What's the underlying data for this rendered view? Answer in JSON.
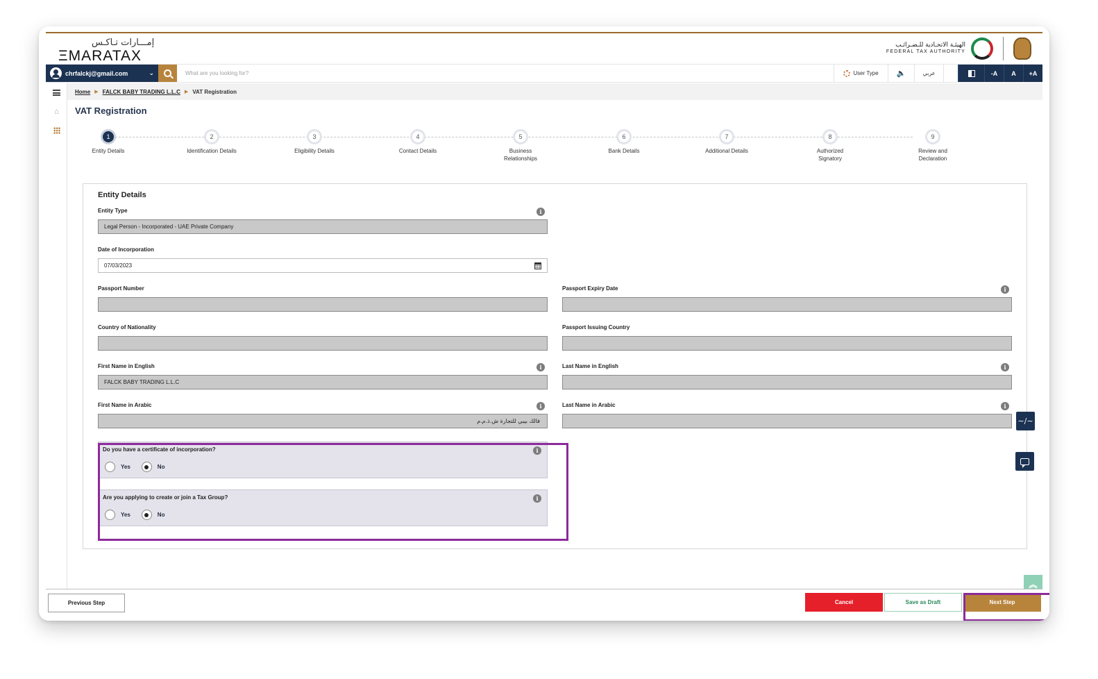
{
  "header": {
    "logo_ar": "إمـــارات تـاكـس",
    "logo_en": "ΞMARATAX",
    "fta_ar": "الهيئـة الاتحـادية للـضـرائـب",
    "fta_en": "FEDERAL TAX AUTHORITY"
  },
  "toolbar": {
    "user_email": "chrfalckj@gmail.com",
    "search_placeholder": "What are you looking for?",
    "user_type_label": "User Type",
    "arabic_label": "عربي",
    "font_decrease": "-A",
    "font_reset": "A",
    "font_increase": "+A"
  },
  "breadcrumb": {
    "items": [
      "Home",
      "FALCK BABY TRADING L.L.C",
      "VAT Registration"
    ]
  },
  "page_title": "VAT Registration",
  "steps": [
    {
      "num": "1",
      "label": "Entity Details"
    },
    {
      "num": "2",
      "label": "Identification Details"
    },
    {
      "num": "3",
      "label": "Eligibility Details"
    },
    {
      "num": "4",
      "label": "Contact Details"
    },
    {
      "num": "5",
      "label": "Business Relationships"
    },
    {
      "num": "6",
      "label": "Bank Details"
    },
    {
      "num": "7",
      "label": "Additional Details"
    },
    {
      "num": "8",
      "label": "Authorized Signatory"
    },
    {
      "num": "9",
      "label": "Review and Declaration"
    }
  ],
  "form": {
    "title": "Entity Details",
    "entity_type": {
      "label": "Entity Type",
      "value": "Legal Person - Incorporated - UAE Private Company"
    },
    "date_of_incorporation": {
      "label": "Date of Incorporation",
      "value": "07/03/2023"
    },
    "passport_number": {
      "label": "Passport Number",
      "value": ""
    },
    "passport_expiry": {
      "label": "Passport Expiry Date",
      "value": ""
    },
    "country_nationality": {
      "label": "Country of Nationality",
      "value": ""
    },
    "passport_issuing_country": {
      "label": "Passport Issuing Country",
      "value": ""
    },
    "first_name_en": {
      "label": "First Name in English",
      "value": "FALCK BABY TRADING L.L.C"
    },
    "last_name_en": {
      "label": "Last Name in English",
      "value": ""
    },
    "first_name_ar": {
      "label": "First Name in Arabic",
      "value": "فالك بيبي للتجارة ش.ذ.م.م"
    },
    "last_name_ar": {
      "label": "Last Name in Arabic",
      "value": ""
    },
    "q_certificate": {
      "question": "Do you have a certificate of incorporation?",
      "yes": "Yes",
      "no": "No",
      "selected": "No"
    },
    "q_tax_group": {
      "question": "Are you applying to create or join a Tax Group?",
      "yes": "Yes",
      "no": "No",
      "selected": "No"
    }
  },
  "footer": {
    "previous": "Previous Step",
    "cancel": "Cancel",
    "save_draft": "Save as Draft",
    "next": "Next Step"
  }
}
